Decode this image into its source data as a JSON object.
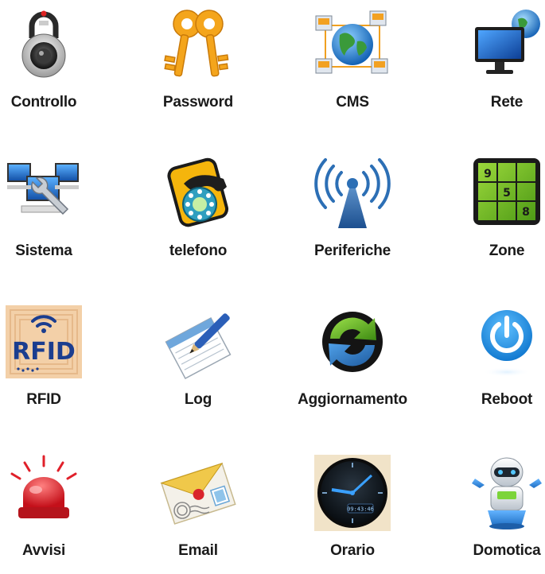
{
  "tiles": [
    {
      "label": "Controllo",
      "icon": "padlock-icon"
    },
    {
      "label": "Password",
      "icon": "keys-icon"
    },
    {
      "label": "CMS",
      "icon": "network-globe-icon"
    },
    {
      "label": "Rete",
      "icon": "monitor-globe-icon"
    },
    {
      "label": "Sistema",
      "icon": "computers-wrench-icon"
    },
    {
      "label": "telefono",
      "icon": "telephone-icon"
    },
    {
      "label": "Periferiche",
      "icon": "wireless-antenna-icon"
    },
    {
      "label": "Zone",
      "icon": "sudoku-grid-icon"
    },
    {
      "label": "RFID",
      "icon": "rfid-tag-icon"
    },
    {
      "label": "Log",
      "icon": "notepad-pen-icon"
    },
    {
      "label": "Aggiornamento",
      "icon": "refresh-arrows-icon"
    },
    {
      "label": "Reboot",
      "icon": "power-button-icon"
    },
    {
      "label": "Avvisi",
      "icon": "siren-light-icon"
    },
    {
      "label": "Email",
      "icon": "envelope-stamp-icon"
    },
    {
      "label": "Orario",
      "icon": "digital-clock-icon"
    },
    {
      "label": "Domotica",
      "icon": "robot-icon"
    }
  ],
  "icon_text": {
    "rfid": "RFID",
    "zone_digits": [
      "9",
      "5",
      "8"
    ],
    "clock_time": "09:43:46"
  },
  "colors": {
    "accent_blue": "#1e88d6",
    "zone_green": "#7ec225",
    "key_gold": "#f4a51c",
    "siren_red": "#e0202a"
  }
}
